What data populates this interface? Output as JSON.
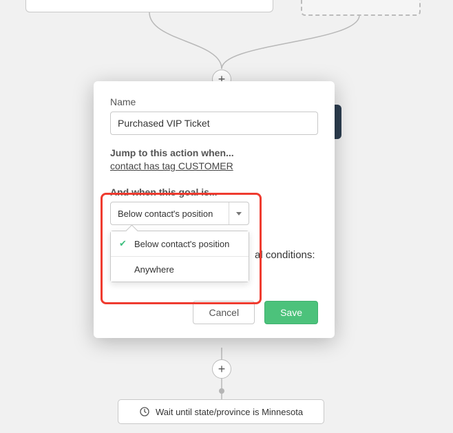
{
  "modal": {
    "name_label": "Name",
    "name_value": "Purchased VIP Ticket",
    "jump_label": "Jump to this action when...",
    "condition_text": "contact has tag CUSTOMER",
    "goal_label": "And when this goal is...",
    "select_value": "Below contact's position",
    "dropdown": {
      "options": [
        {
          "label": "Below contact's position",
          "selected": true
        },
        {
          "label": "Anywhere",
          "selected": false
        }
      ]
    },
    "behind_text_fragment": "al conditions:",
    "cancel": "Cancel",
    "save": "Save"
  },
  "flow": {
    "plus": "+",
    "wait_card": "Wait until state/province is Minnesota"
  }
}
